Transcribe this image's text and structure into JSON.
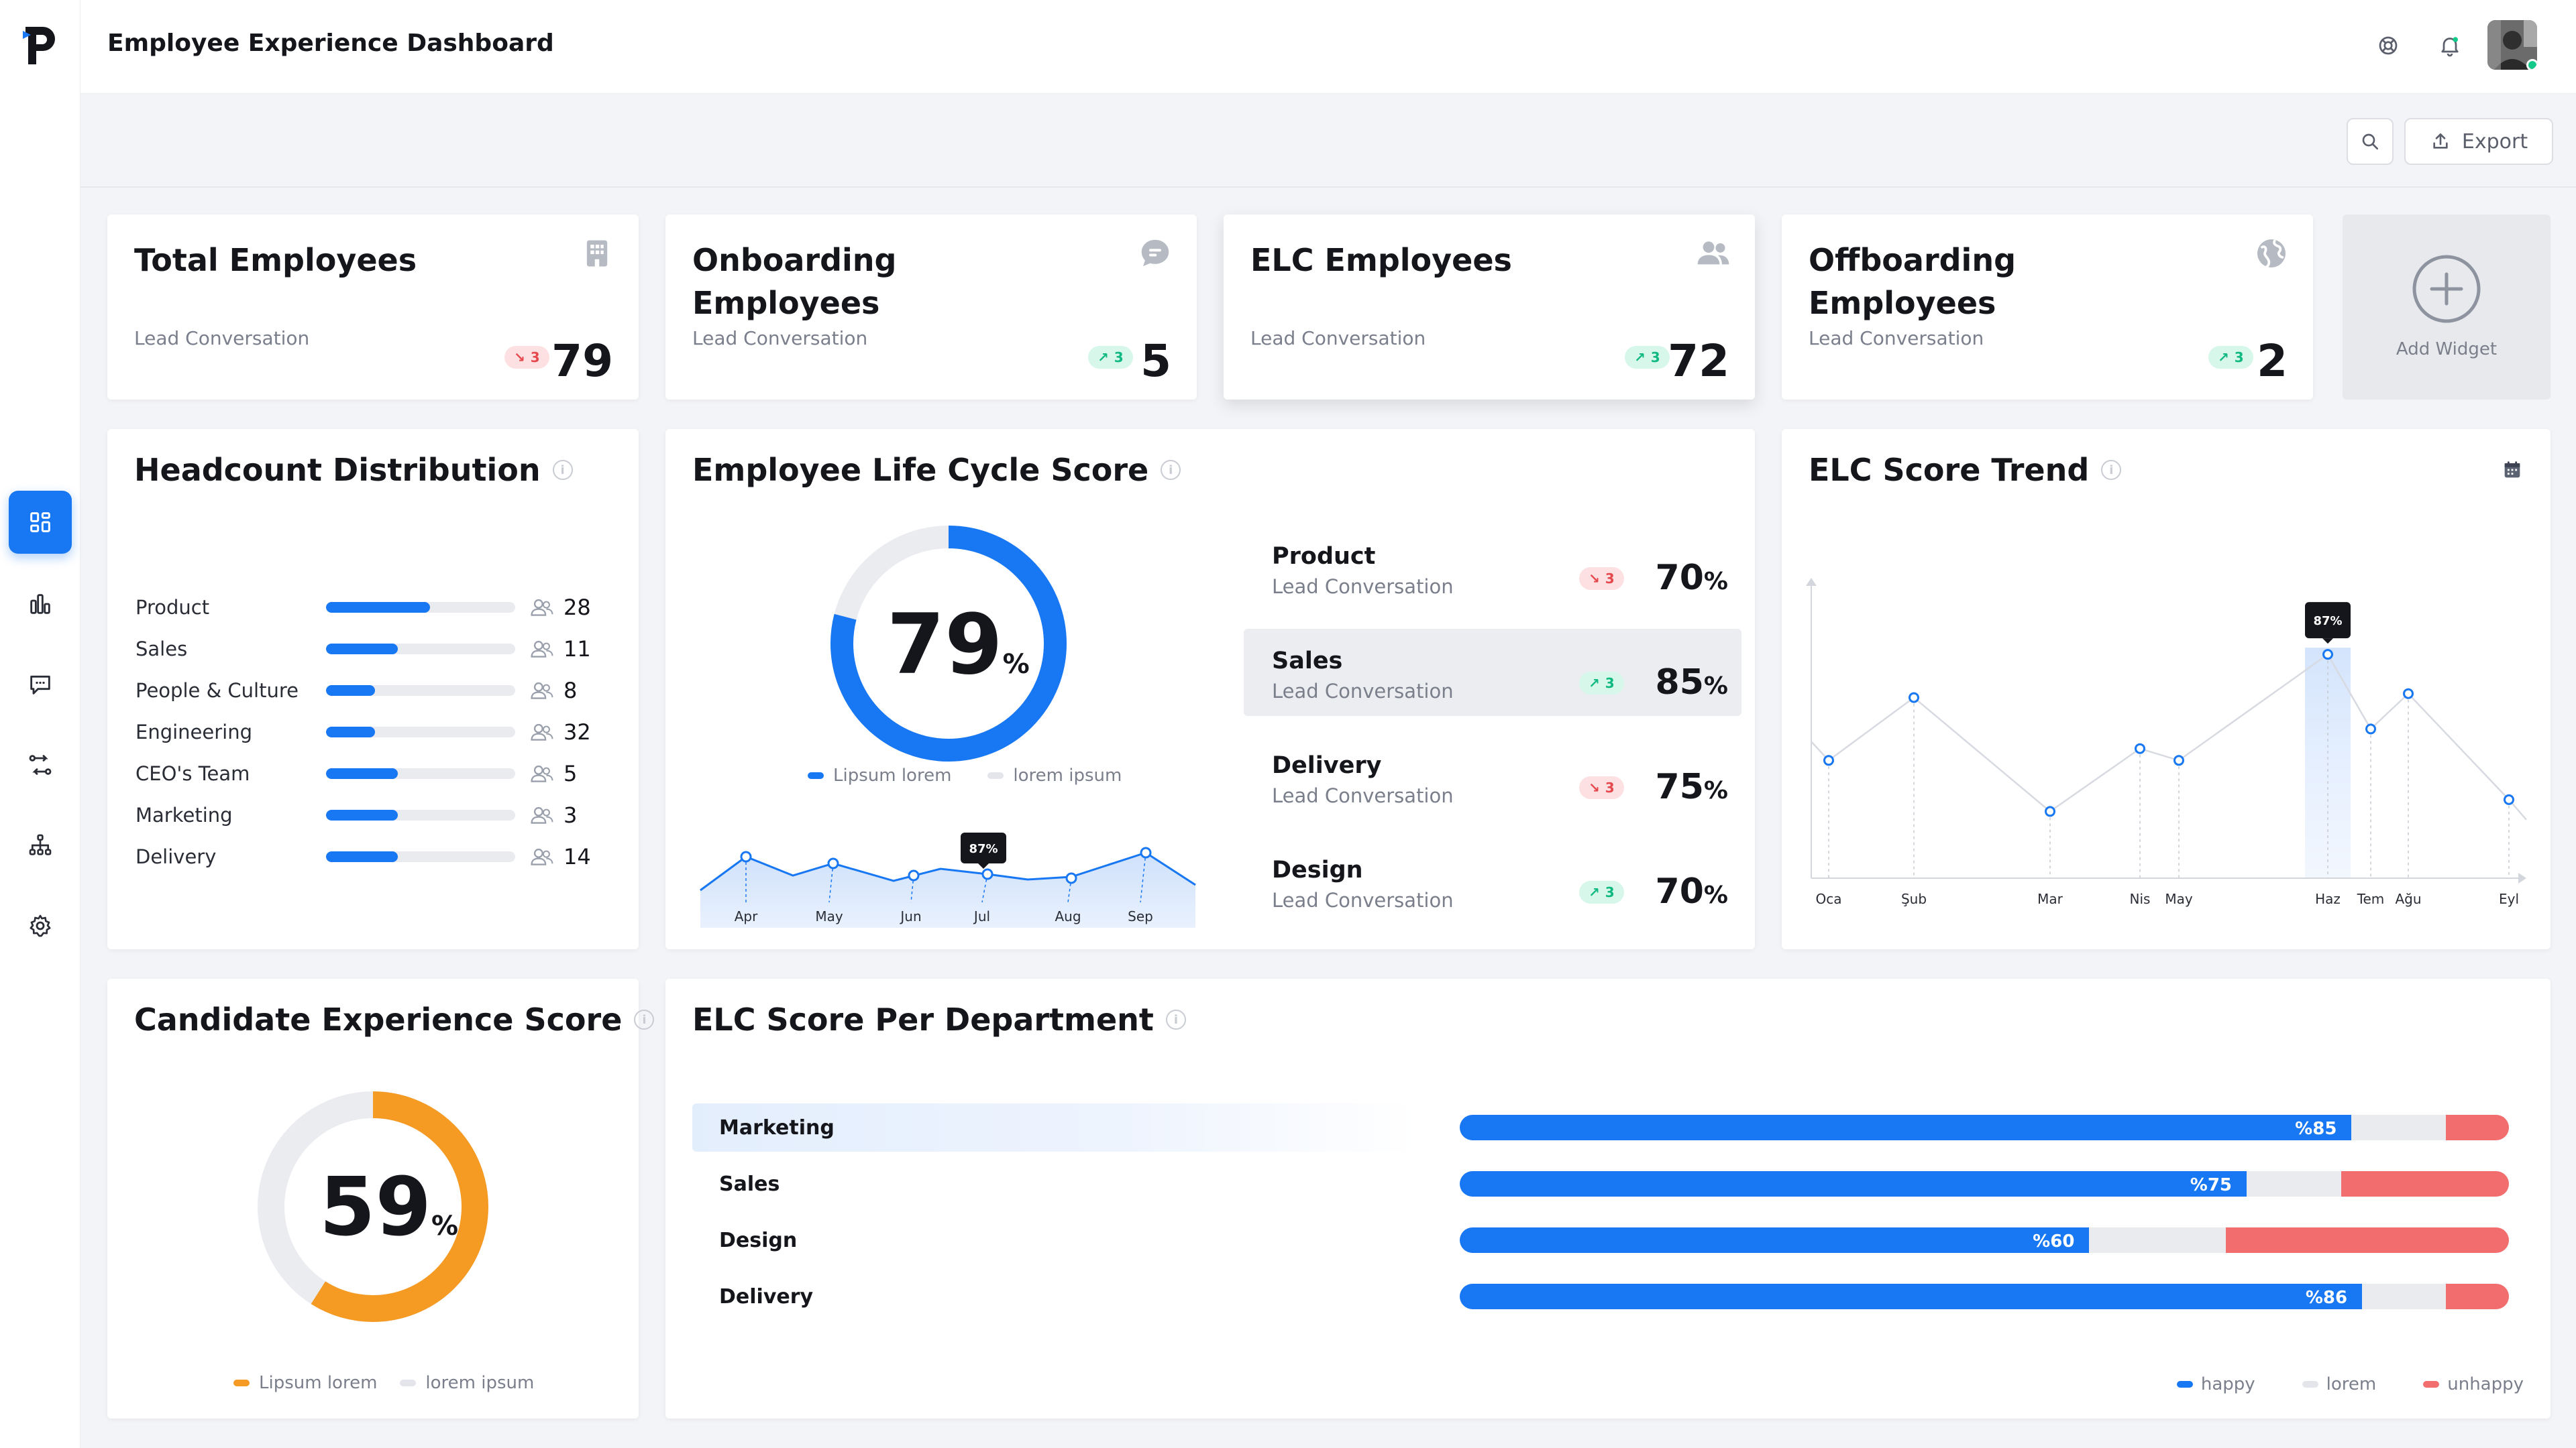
{
  "header": {
    "title": "Employee Experience Dashboard"
  },
  "toolbar": {
    "export_label": "Export"
  },
  "colors": {
    "primary": "#1877f2",
    "danger": "#e5484d",
    "success": "#10b981",
    "orange": "#f59a23",
    "unhappy": "#f26d6d"
  },
  "stats": [
    {
      "title": "Total Employees",
      "sub": "Lead Conversation",
      "trend": "3",
      "direction": "down",
      "value": "79",
      "icon": "building-icon"
    },
    {
      "title": "Onboarding Employees",
      "sub": "Lead Conversation",
      "trend": "3",
      "direction": "up",
      "value": "5",
      "icon": "chat-bubble-icon"
    },
    {
      "title": "ELC Employees",
      "sub": "Lead Conversation",
      "trend": "3",
      "direction": "up",
      "value": "72",
      "icon": "users-icon"
    },
    {
      "title": "Offboarding Employees",
      "sub": "Lead Conversation",
      "trend": "3",
      "direction": "up",
      "value": "2",
      "icon": "globe-icon"
    }
  ],
  "add_widget": {
    "label": "Add Widget"
  },
  "headcount": {
    "title": "Headcount Distribution",
    "rows": [
      {
        "label": "Product",
        "count": "28",
        "fill": 0.55
      },
      {
        "label": "Sales",
        "count": "11",
        "fill": 0.38
      },
      {
        "label": "People & Culture",
        "count": "8",
        "fill": 0.26
      },
      {
        "label": "Engineering",
        "count": "32",
        "fill": 0.26
      },
      {
        "label": "CEO's Team",
        "count": "5",
        "fill": 0.38
      },
      {
        "label": "Marketing",
        "count": "3",
        "fill": 0.38
      },
      {
        "label": "Delivery",
        "count": "14",
        "fill": 0.38
      }
    ]
  },
  "lifecycle": {
    "title": "Employee Life Cycle Score",
    "score": "79",
    "score_fraction": 0.79,
    "unit": "%",
    "legend": [
      "Lipsum lorem",
      "lorem ipsum"
    ],
    "mini_chart": {
      "labels": [
        "Apr",
        "May",
        "Jun",
        "Jul",
        "Aug",
        "Sep"
      ],
      "tooltip": "87%"
    },
    "departments": [
      {
        "name": "Product",
        "sub": "Lead Conversation",
        "trend": "3",
        "direction": "down",
        "value": "70"
      },
      {
        "name": "Sales",
        "sub": "Lead Conversation",
        "trend": "3",
        "direction": "up",
        "value": "85"
      },
      {
        "name": "Delivery",
        "sub": "Lead Conversation",
        "trend": "3",
        "direction": "down",
        "value": "75"
      },
      {
        "name": "Design",
        "sub": "Lead Conversation",
        "trend": "3",
        "direction": "up",
        "value": "70"
      }
    ]
  },
  "trend": {
    "title": "ELC Score Trend",
    "tooltip": "87%",
    "chart_data": {
      "type": "line",
      "x": [
        "Oca",
        "Şub",
        "Mar",
        "Nis",
        "May",
        "Haz",
        "Tem",
        "Ağu",
        "Eyl"
      ],
      "y": [
        60,
        76,
        47,
        63,
        60,
        87,
        68,
        77,
        50
      ],
      "highlight": "Haz"
    }
  },
  "candidate": {
    "title": "Candidate Experience Score",
    "score": "59",
    "score_fraction": 0.59,
    "unit": "%",
    "legend": [
      "Lipsum lorem",
      "lorem ipsum"
    ]
  },
  "elc_dept": {
    "title": "ELC Score Per Department",
    "chart_data": {
      "type": "bar",
      "categories": [
        "Marketing",
        "Sales",
        "Design",
        "Delivery"
      ],
      "series": [
        {
          "name": "happy",
          "values": [
            85,
            75,
            60,
            86
          ]
        },
        {
          "name": "lorem",
          "values": [
            9,
            9,
            13,
            8
          ]
        },
        {
          "name": "unhappy",
          "values": [
            6,
            16,
            27,
            6
          ]
        }
      ],
      "value_labels": [
        "%85",
        "%75",
        "%60",
        "%86"
      ]
    },
    "legend": [
      "happy",
      "lorem",
      "unhappy"
    ]
  }
}
